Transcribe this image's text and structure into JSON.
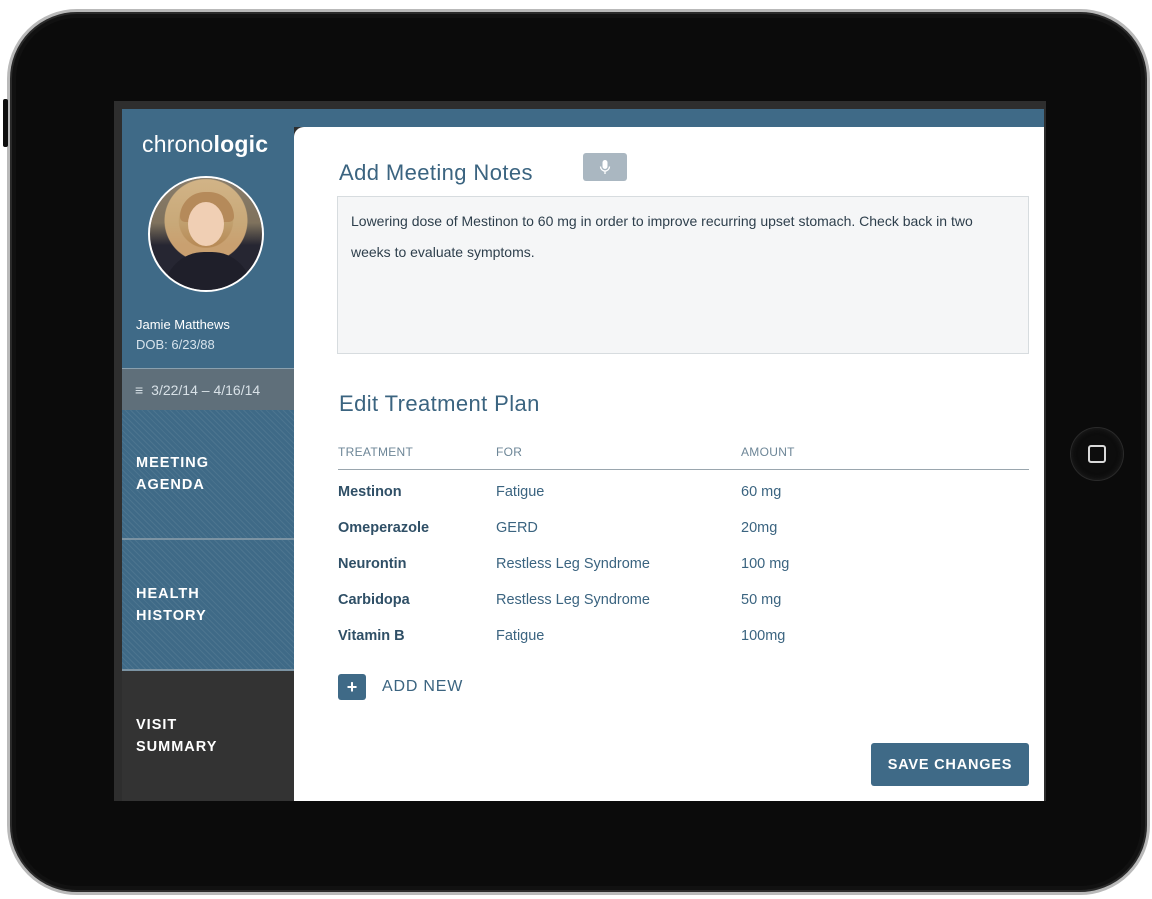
{
  "app": {
    "logo_light": "chrono",
    "logo_bold": "logic"
  },
  "patient": {
    "name": "Jamie Matthews",
    "dob": "DOB: 6/23/88"
  },
  "sidebar": {
    "date_range": "3/22/14 – 4/16/14",
    "date_range_icon": "menu-icon",
    "items": [
      {
        "line1": "MEETING",
        "line2": "AGENDA"
      },
      {
        "line1": "HEALTH",
        "line2": "HISTORY"
      },
      {
        "line1": "VISIT",
        "line2": "SUMMARY"
      }
    ]
  },
  "notes": {
    "heading": "Add Meeting Notes",
    "mic_icon": "microphone-icon",
    "text": "Lowering dose of Mestinon to 60 mg in order to improve recurring upset stomach. Check back in two weeks to evaluate symptoms."
  },
  "plan": {
    "heading": "Edit Treatment Plan",
    "columns": [
      "TREATMENT",
      "FOR",
      "AMOUNT"
    ],
    "rows": [
      {
        "treatment": "Mestinon",
        "for": "Fatigue",
        "amount": "60 mg"
      },
      {
        "treatment": "Omeperazole",
        "for": "GERD",
        "amount": "20mg"
      },
      {
        "treatment": "Neurontin",
        "for": "Restless Leg Syndrome",
        "amount": "100 mg"
      },
      {
        "treatment": "Carbidopa",
        "for": "Restless Leg Syndrome",
        "amount": "50 mg"
      },
      {
        "treatment": "Vitamin B",
        "for": "Fatigue",
        "amount": "100mg"
      }
    ],
    "add_new_label": "ADD NEW",
    "add_icon": "plus-icon"
  },
  "actions": {
    "save_label": "SAVE CHANGES"
  },
  "colors": {
    "primary": "#3f6a87",
    "active_nav": "#333333",
    "muted_button": "#aab7c1"
  }
}
